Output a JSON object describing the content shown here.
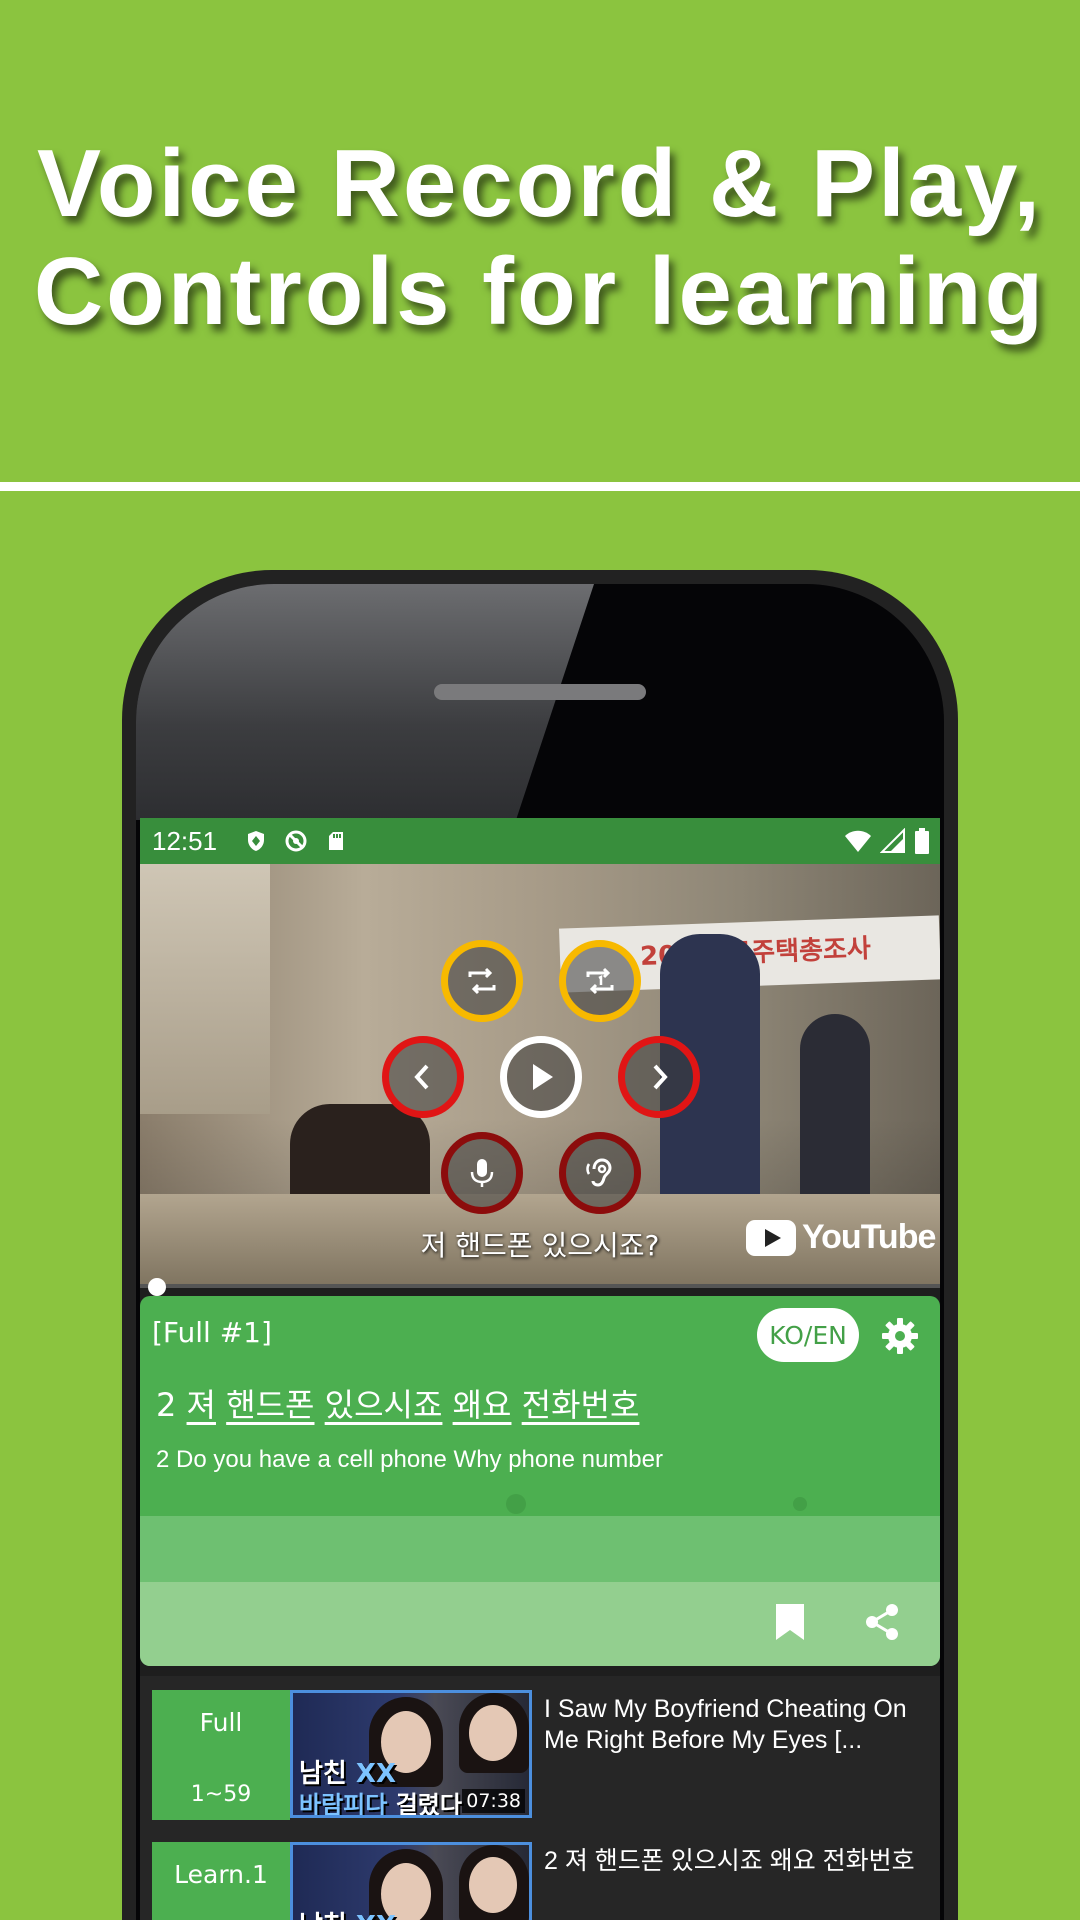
{
  "headline": {
    "line1": "Voice Record & Play,",
    "line2": "Controls for learning"
  },
  "status_bar": {
    "time": "12:51",
    "icons_left": [
      "shield-icon",
      "sync-off-icon",
      "sd-card-icon"
    ],
    "icons_right": [
      "wifi-icon",
      "cell-signal-icon",
      "battery-icon"
    ]
  },
  "video": {
    "banner_text": "200 인구주택총조사",
    "subtitle": "저 핸드폰 있으시죠?",
    "brand": "YouTube",
    "controls": [
      "repeat-icon",
      "repeat-one-icon",
      "previous-icon",
      "play-icon",
      "next-icon",
      "mic-icon",
      "hearing-icon"
    ]
  },
  "card": {
    "title": "[Full #1]",
    "lang_toggle": "KO/EN",
    "korean_words": [
      "2",
      "져",
      "핸드폰",
      "있으시죠",
      "왜요",
      "전화번호"
    ],
    "english": "2 Do you have a cell phone Why phone number"
  },
  "list": [
    {
      "label": "Full",
      "range": "1~59",
      "thumb_line1_a": "남친",
      "thumb_line1_b": "XX",
      "thumb_line2_a": "바람피다",
      "thumb_line2_b": "걸렸다",
      "duration": "07:38",
      "title": "I Saw My Boyfriend Cheating On Me Right Before My Eyes [..."
    },
    {
      "label": "Learn.1",
      "range": "",
      "thumb_line1_a": "남친",
      "thumb_line1_b": "XX",
      "thumb_line2_a": "",
      "thumb_line2_b": "",
      "duration": "",
      "title": "2 져 핸드폰 있으시죠 왜요 전화번호"
    }
  ],
  "colors": {
    "background": "#8bc43f",
    "status_bar": "#388e3c",
    "card": "#4caf50",
    "repeat_ring": "#f7b900",
    "nav_ring": "#e01515",
    "record_ring": "#8c0c0c"
  }
}
